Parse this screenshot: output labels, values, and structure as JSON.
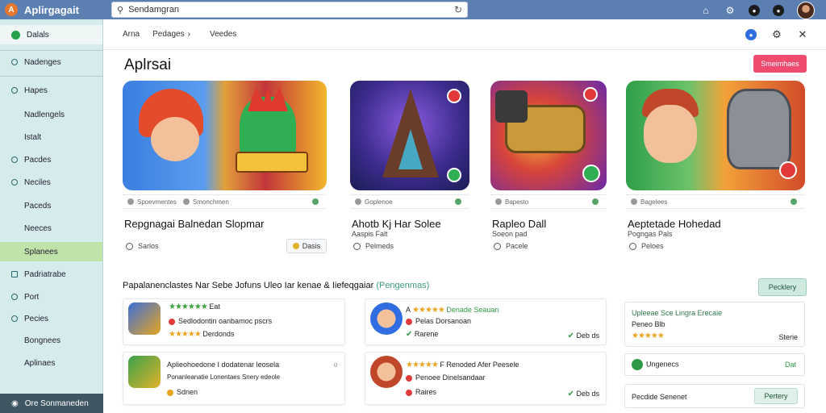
{
  "app": {
    "title": "Aplirgagait",
    "logo_letter": "A"
  },
  "search": {
    "value": "Sendamgran",
    "placeholder": ""
  },
  "sidebar": {
    "items": [
      {
        "label": "Dalals"
      },
      {
        "label": "Nadenges"
      },
      {
        "label": "Hapes"
      },
      {
        "label": "Nadlengels"
      },
      {
        "label": "Istalt"
      },
      {
        "label": "Pacdes"
      },
      {
        "label": "Neciles"
      },
      {
        "label": "Paceds"
      },
      {
        "label": "Neeces"
      },
      {
        "label": "Splanees"
      },
      {
        "label": "Padriatrabe"
      },
      {
        "label": "Port"
      },
      {
        "label": "Pecies"
      },
      {
        "label": "Bongnees"
      },
      {
        "label": "Aplinaes"
      }
    ],
    "footer": "Ore Sonmaneden"
  },
  "breadcrumb": [
    "Arna",
    "Pedages",
    "Veedes"
  ],
  "page": {
    "title": "Aplrsai",
    "primary_button": "Smeimhaes"
  },
  "cards": [
    {
      "meta": "Spoevmentes",
      "meta2": "Smonchmen",
      "title": "Repgnagai Balnedan Slopmar",
      "sub": "",
      "foot": "Sarlos",
      "save": "Dasis"
    },
    {
      "meta": "Goplenoe",
      "meta2": "",
      "title": "Ahotb Kj Har Solee",
      "sub": "Aaspis Falt",
      "foot": "Pelmeds",
      "save": ""
    },
    {
      "meta": "Bapesto",
      "meta2": "",
      "title": "Rapleo Dall",
      "sub": "Soeon pad",
      "foot": "Pacele",
      "save": ""
    },
    {
      "meta": "Bagelees",
      "meta2": "",
      "title": "Aeptetade Hohedad",
      "sub": "Pogngas Pals",
      "foot": "Peloes",
      "save": ""
    }
  ],
  "section": {
    "title": "Papalanenclastes Nar Sebe Jofuns Uleo Iar kenae & Iiefeqgaiar",
    "tag": "(Pengenmas)",
    "button": "Pecklery"
  },
  "rows": [
    {
      "stars_top": "★★★★★★",
      "top_text": "Eat",
      "line2": "Sedlodontin oanbamoc pscrs",
      "line3": "Derdonds",
      "stars3": "★★★★★",
      "badge": ""
    },
    {
      "stars_top": "★★★★★",
      "top_text": "A",
      "line_a": "Denade Seauan",
      "line2": "Pelas Dorsanoan",
      "line3": "Rarene",
      "badge": "Deb ds"
    },
    {
      "stars_top": "",
      "top_text": "Aplieohoedone I dodatenar leosela",
      "line2": "Ponanleanatie Lonentaes Snery edeole",
      "line3": "Sdnen",
      "badge": ""
    },
    {
      "stars_top": "★★★★★",
      "top_text": "F Renoded Afer Peesele",
      "line2": "Penoee Dinelsandaar",
      "line3": "Raires",
      "badge": "Deb ds"
    }
  ],
  "side": {
    "card1_title": "Upleeae Sce Lingra Erecaie",
    "card1_line2": "Peneo Blb",
    "card1_meta": "Sterie",
    "card2_label": "Ungenecs",
    "card2_meta": "Dat",
    "card3_label": "Pecdide Senenet",
    "card3_button": "Pertery"
  },
  "colors": {
    "accent": "#ee4b6e",
    "topbar": "#5b7fb1",
    "sidebar": "#d5ebec",
    "sidebar_active": "#bfe3a9"
  }
}
